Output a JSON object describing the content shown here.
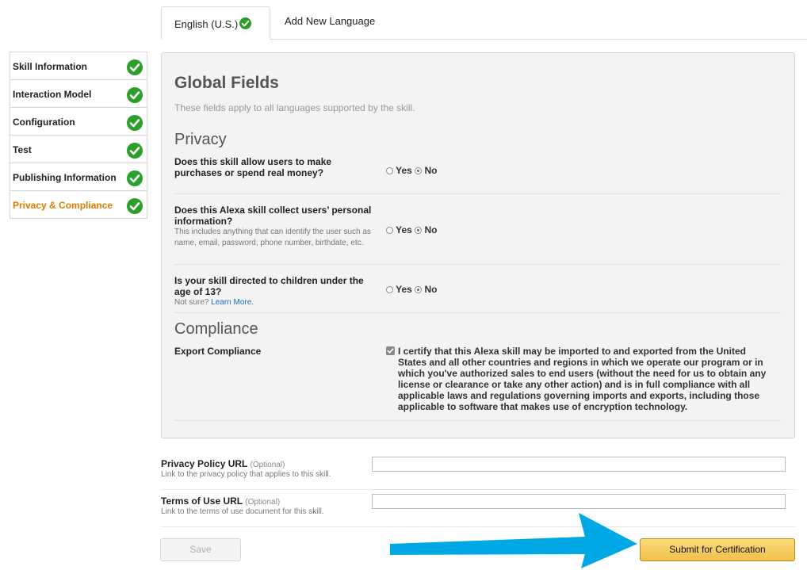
{
  "tabs": {
    "active_label": "English (U.S.)",
    "add_label": "Add New Language"
  },
  "sidebar": {
    "items": [
      {
        "label": "Skill Information",
        "complete": true
      },
      {
        "label": "Interaction Model",
        "complete": true
      },
      {
        "label": "Configuration",
        "complete": true
      },
      {
        "label": "Test",
        "complete": true
      },
      {
        "label": "Publishing Information",
        "complete": true
      },
      {
        "label": "Privacy & Compliance",
        "complete": true
      }
    ]
  },
  "global": {
    "title": "Global Fields",
    "subtitle": "These fields apply to all languages supported by the skill.",
    "privacy_heading": "Privacy",
    "questions": [
      {
        "question": "Does this skill allow users to make purchases or spend real money?",
        "help": "",
        "yes": "Yes",
        "no": "No",
        "selected": "No"
      },
      {
        "question": "Does this Alexa skill collect users’ personal information?",
        "help": "This includes anything that can identify the user such as name, email, password, phone number, birthdate, etc.",
        "yes": "Yes",
        "no": "No",
        "selected": "No"
      },
      {
        "question": "Is your skill directed to children under the age of 13?",
        "help": "Not sure?",
        "help_link": "Learn More.",
        "yes": "Yes",
        "no": "No",
        "selected": "No"
      }
    ],
    "compliance_heading": "Compliance",
    "export_label": "Export Compliance",
    "export_checked": true,
    "export_text": "I certify that this Alexa skill may be imported to and exported from the United States and all other countries and regions in which we operate our program or in which you've authorized sales to end users (without the need for us to obtain any license or clearance or take any other action) and is in full compliance with all applicable laws and regulations governing imports and exports, including those applicable to software that makes use of encryption technology."
  },
  "privacy_url": {
    "label": "Privacy Policy URL",
    "optional": "(Optional)",
    "help": "Link to the privacy policy that applies to this skill.",
    "value": ""
  },
  "terms_url": {
    "label": "Terms of Use URL",
    "optional": "(Optional)",
    "help": "Link to the terms of use document for this skill.",
    "value": ""
  },
  "buttons": {
    "save": "Save",
    "submit": "Submit for Certification"
  },
  "colors": {
    "accent_orange": "#e07b00",
    "check_green": "#2aa02a",
    "submit_yellow": "#f0c14b",
    "arrow_blue": "#00a8e6",
    "link_blue": "#1b6ec2"
  }
}
